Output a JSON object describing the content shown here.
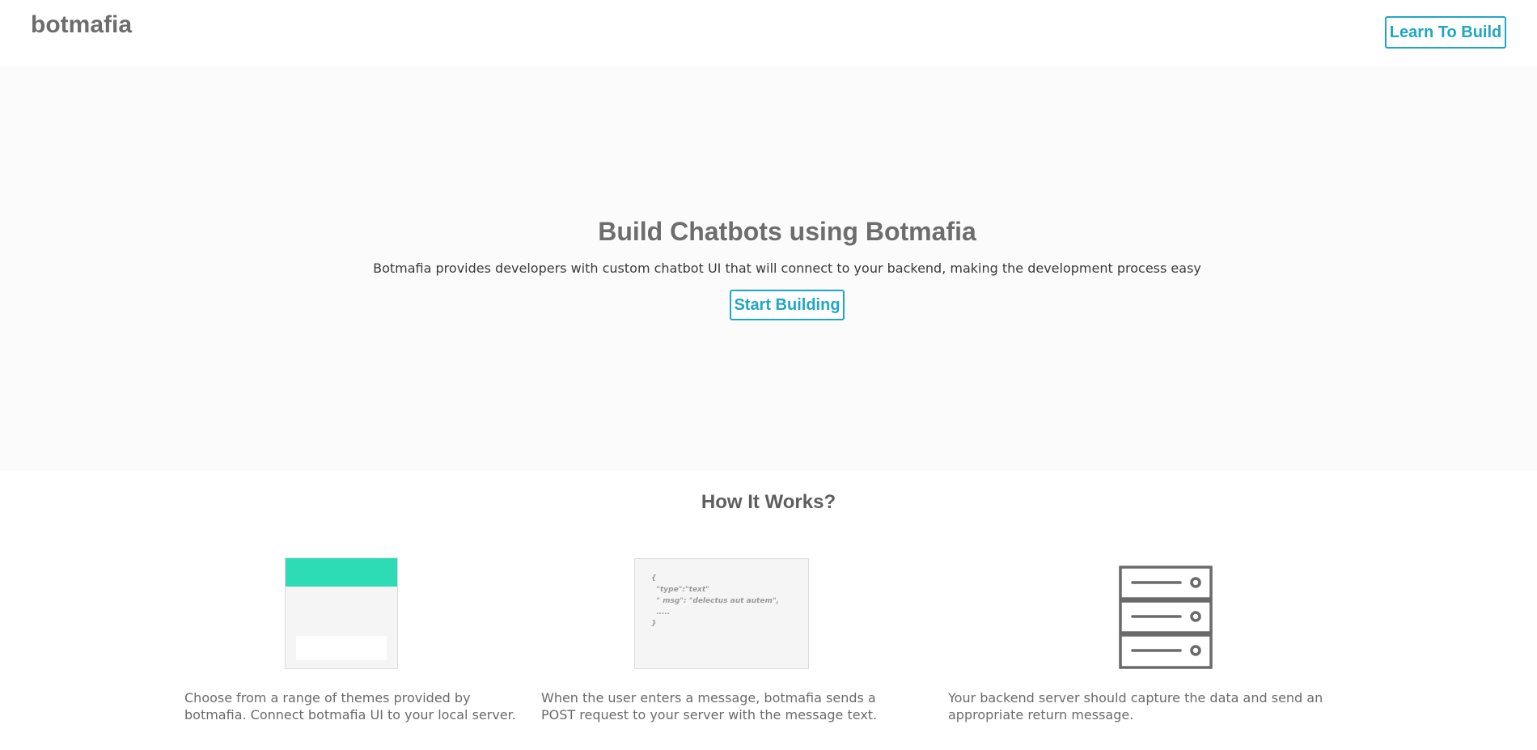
{
  "header": {
    "brand": "botmafia",
    "learn_button": "Learn To Build"
  },
  "hero": {
    "title": "Build Chatbots using Botmafia",
    "subtitle": "Botmafia provides developers with custom chatbot UI that will connect to your backend, making the development process easy",
    "cta": "Start Building"
  },
  "how": {
    "title": "How It Works?",
    "code_sample": "{\n  \"type\":\"text\"\n  \" msg\": \"delectus aut autem\",\n  .....\n}",
    "steps": [
      {
        "icon": "theme-preview-icon",
        "text": "Choose from a range of themes provided by botmafia. Connect botmafia UI to your local server."
      },
      {
        "icon": "json-code-icon",
        "text": "When the user enters a message, botmafia sends a POST request to your server with the message text."
      },
      {
        "icon": "server-icon",
        "text": "Your backend server should capture the data and send an appropriate return message."
      }
    ]
  },
  "colors": {
    "accent": "#1fa7c1",
    "theme_green": "#2ddbb4",
    "text_gray": "#6d6d6d",
    "hero_bg": "#fbfbfb"
  }
}
